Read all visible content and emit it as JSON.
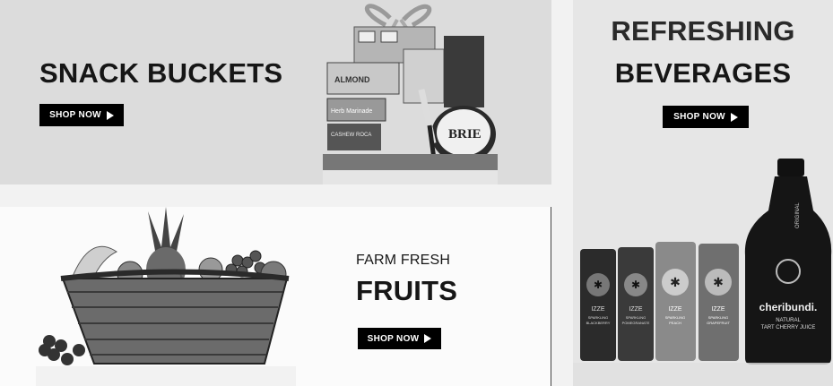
{
  "snack": {
    "title": "SNACK BUCKETS",
    "button": "SHOP NOW"
  },
  "beverages": {
    "title_line1": "REFRESHING",
    "title_line2": "BEVERAGES",
    "button": "SHOP NOW",
    "cans": [
      {
        "brand": "IZZE",
        "flavor_line1": "SPARKLING",
        "flavor_line2": "BLACKBERRY"
      },
      {
        "brand": "IZZE",
        "flavor_line1": "SPARKLING",
        "flavor_line2": "POMEGRANATE"
      },
      {
        "brand": "IZZE",
        "flavor_line1": "SPARKLING",
        "flavor_line2": "PEACH"
      },
      {
        "brand": "IZZE",
        "flavor_line1": "SPARKLING",
        "flavor_line2": "GRAPEFRUIT"
      }
    ],
    "bottle": {
      "brand": "cheribundi.",
      "label_top": "ORIGINAL",
      "label_line1": "NATURAL",
      "label_line2": "TART CHERRY JUICE"
    }
  },
  "fruits": {
    "kicker": "FARM FRESH",
    "title": "FRUITS",
    "button": "SHOP NOW"
  },
  "gift_box": {
    "cheese_label": "BRIE"
  },
  "colors": {
    "button_bg": "#000000",
    "button_text": "#ffffff",
    "snack_bg": "#dcdcdc",
    "bev_bg": "#e6e6e6",
    "fruit_bg": "#fbfbfb"
  }
}
